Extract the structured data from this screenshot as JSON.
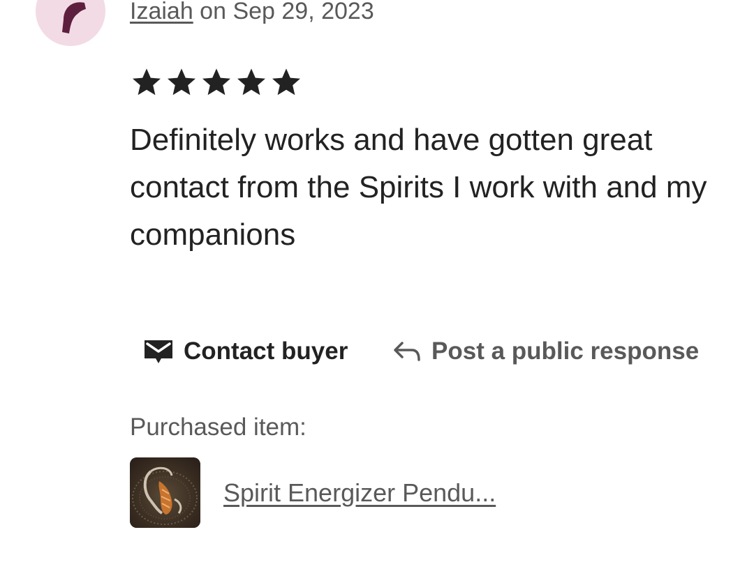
{
  "review": {
    "reviewer_name": "Izaiah",
    "date_text": " on Sep 29, 2023",
    "rating": 5,
    "rating_max": 5,
    "text": "Definitely works and have gotten great contact from the Spirits I work with and my companions"
  },
  "actions": {
    "contact_buyer": {
      "label": "Contact buyer",
      "icon": "envelope-icon"
    },
    "public_response": {
      "label": "Post a public response",
      "icon": "reply-arrow-icon"
    }
  },
  "purchased": {
    "label": "Purchased item:",
    "item_title": "Spirit Energizer Pendu..."
  },
  "colors": {
    "avatar_bg": "#f2dbe5",
    "avatar_glyph": "#5e1f3f",
    "text_primary": "#222222",
    "text_secondary": "#595959"
  }
}
